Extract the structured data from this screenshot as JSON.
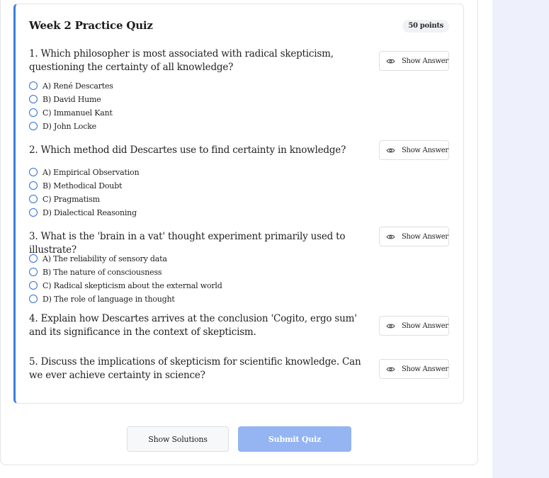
{
  "quiz": {
    "title": "Week 2 Practice Quiz",
    "points": "50 points",
    "show_answer_label": "Show Answer",
    "questions": [
      {
        "text": "1. Which philosopher is most associated with radical skepticism, questioning the certainty of all knowledge?",
        "options": [
          "A) René Descartes",
          "B) David Hume",
          "C) Immanuel Kant",
          "D) John Locke"
        ]
      },
      {
        "text": "2. Which method did Descartes use to find certainty in knowledge?",
        "options": [
          "A) Empirical Observation",
          "B) Methodical Doubt",
          "C) Pragmatism",
          "D) Dialectical Reasoning"
        ]
      },
      {
        "text": "3. What is the 'brain in a vat' thought experiment primarily used to illustrate?",
        "options": [
          "A) The reliability of sensory data",
          "B) The nature of consciousness",
          "C) Radical skepticism about the external world",
          "D) The role of language in thought"
        ]
      },
      {
        "text": "4. Explain how Descartes arrives at the conclusion 'Cogito, ergo sum' and its significance in the context of skepticism.",
        "options": []
      },
      {
        "text": "5. Discuss the implications of skepticism for scientific knowledge. Can we ever achieve certainty in science?",
        "options": []
      }
    ]
  },
  "footer": {
    "show_solutions_label": "Show Solutions",
    "submit_label": "Submit Quiz"
  },
  "colors": {
    "accent": "#3b7ddd",
    "radio": "#2f6fd6",
    "submit_disabled": "#94b5f2",
    "side_panel": "#eef1fb"
  },
  "icons": {
    "show_answer": "eye-icon",
    "option": "radio-icon"
  }
}
